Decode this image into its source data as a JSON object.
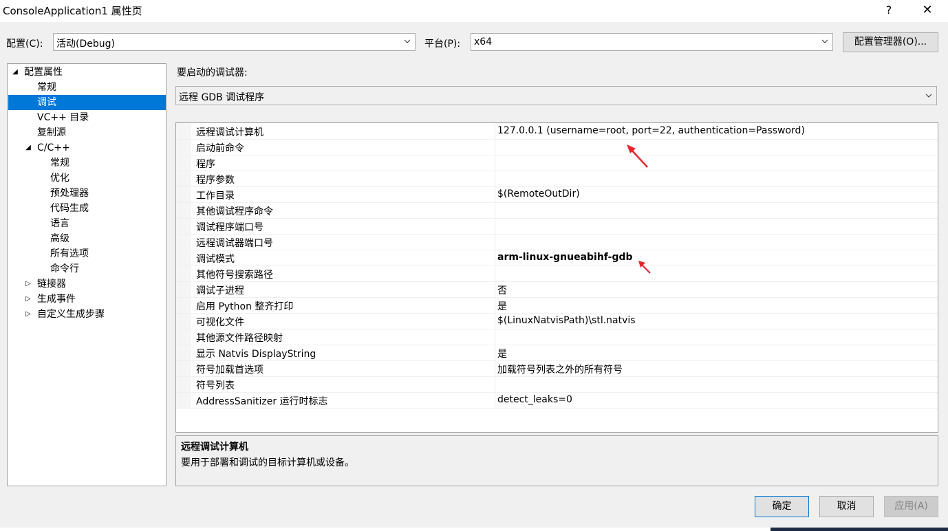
{
  "window": {
    "title": "ConsoleApplication1 属性页",
    "help_label": "?",
    "close_label": "✕"
  },
  "toolbar": {
    "config_label": "配置(C):",
    "config_value": "活动(Debug)",
    "platform_label": "平台(P):",
    "platform_value": "x64",
    "config_manager_label": "配置管理器(O)..."
  },
  "tree": {
    "items": [
      {
        "label": "配置属性",
        "expander": "◢",
        "level": 0,
        "selected": false
      },
      {
        "label": "常规",
        "expander": "",
        "level": 1,
        "selected": false
      },
      {
        "label": "调试",
        "expander": "",
        "level": 1,
        "selected": true
      },
      {
        "label": "VC++ 目录",
        "expander": "",
        "level": 1,
        "selected": false
      },
      {
        "label": "复制源",
        "expander": "",
        "level": 1,
        "selected": false
      },
      {
        "label": "C/C++",
        "expander": "◢",
        "level": 1,
        "selected": false
      },
      {
        "label": "常规",
        "expander": "",
        "level": 2,
        "selected": false
      },
      {
        "label": "优化",
        "expander": "",
        "level": 2,
        "selected": false
      },
      {
        "label": "预处理器",
        "expander": "",
        "level": 2,
        "selected": false
      },
      {
        "label": "代码生成",
        "expander": "",
        "level": 2,
        "selected": false
      },
      {
        "label": "语言",
        "expander": "",
        "level": 2,
        "selected": false
      },
      {
        "label": "高级",
        "expander": "",
        "level": 2,
        "selected": false
      },
      {
        "label": "所有选项",
        "expander": "",
        "level": 2,
        "selected": false
      },
      {
        "label": "命令行",
        "expander": "",
        "level": 2,
        "selected": false
      },
      {
        "label": "链接器",
        "expander": "▷",
        "level": 1,
        "selected": false
      },
      {
        "label": "生成事件",
        "expander": "▷",
        "level": 1,
        "selected": false
      },
      {
        "label": "自定义生成步骤",
        "expander": "▷",
        "level": 1,
        "selected": false
      }
    ]
  },
  "debugger": {
    "label": "要启动的调试器:",
    "value": "远程 GDB 调试程序"
  },
  "properties": [
    {
      "name": "远程调试计算机",
      "value": "127.0.0.1 (username=root, port=22, authentication=Password)",
      "bold": false
    },
    {
      "name": "启动前命令",
      "value": "",
      "bold": false
    },
    {
      "name": "程序",
      "value": "",
      "bold": false
    },
    {
      "name": "程序参数",
      "value": "",
      "bold": false
    },
    {
      "name": "工作目录",
      "value": "$(RemoteOutDir)",
      "bold": false
    },
    {
      "name": "其他调试程序命令",
      "value": "",
      "bold": false
    },
    {
      "name": "调试程序端口号",
      "value": "",
      "bold": false
    },
    {
      "name": "远程调试器端口号",
      "value": "",
      "bold": false
    },
    {
      "name": "调试模式",
      "value": "arm-linux-gnueabihf-gdb",
      "bold": true
    },
    {
      "name": "其他符号搜索路径",
      "value": "",
      "bold": false
    },
    {
      "name": "调试子进程",
      "value": "否",
      "bold": false
    },
    {
      "name": "启用 Python 整齐打印",
      "value": "是",
      "bold": false
    },
    {
      "name": "可视化文件",
      "value": "$(LinuxNatvisPath)\\stl.natvis",
      "bold": false
    },
    {
      "name": "其他源文件路径映射",
      "value": "",
      "bold": false
    },
    {
      "name": "显示 Natvis DisplayString",
      "value": "是",
      "bold": false
    },
    {
      "name": "符号加载首选项",
      "value": "加载符号列表之外的所有符号",
      "bold": false
    },
    {
      "name": "符号列表",
      "value": "",
      "bold": false
    },
    {
      "name": "AddressSanitizer 运行时标志",
      "value": "detect_leaks=0",
      "bold": false
    }
  ],
  "description": {
    "title": "远程调试计算机",
    "text": "要用于部署和调试的目标计算机或设备。"
  },
  "buttons": {
    "ok": "确定",
    "cancel": "取消",
    "apply": "应用(A)"
  },
  "colors": {
    "selection": "#0078d7",
    "annotation_arrow": "#e8262b"
  }
}
